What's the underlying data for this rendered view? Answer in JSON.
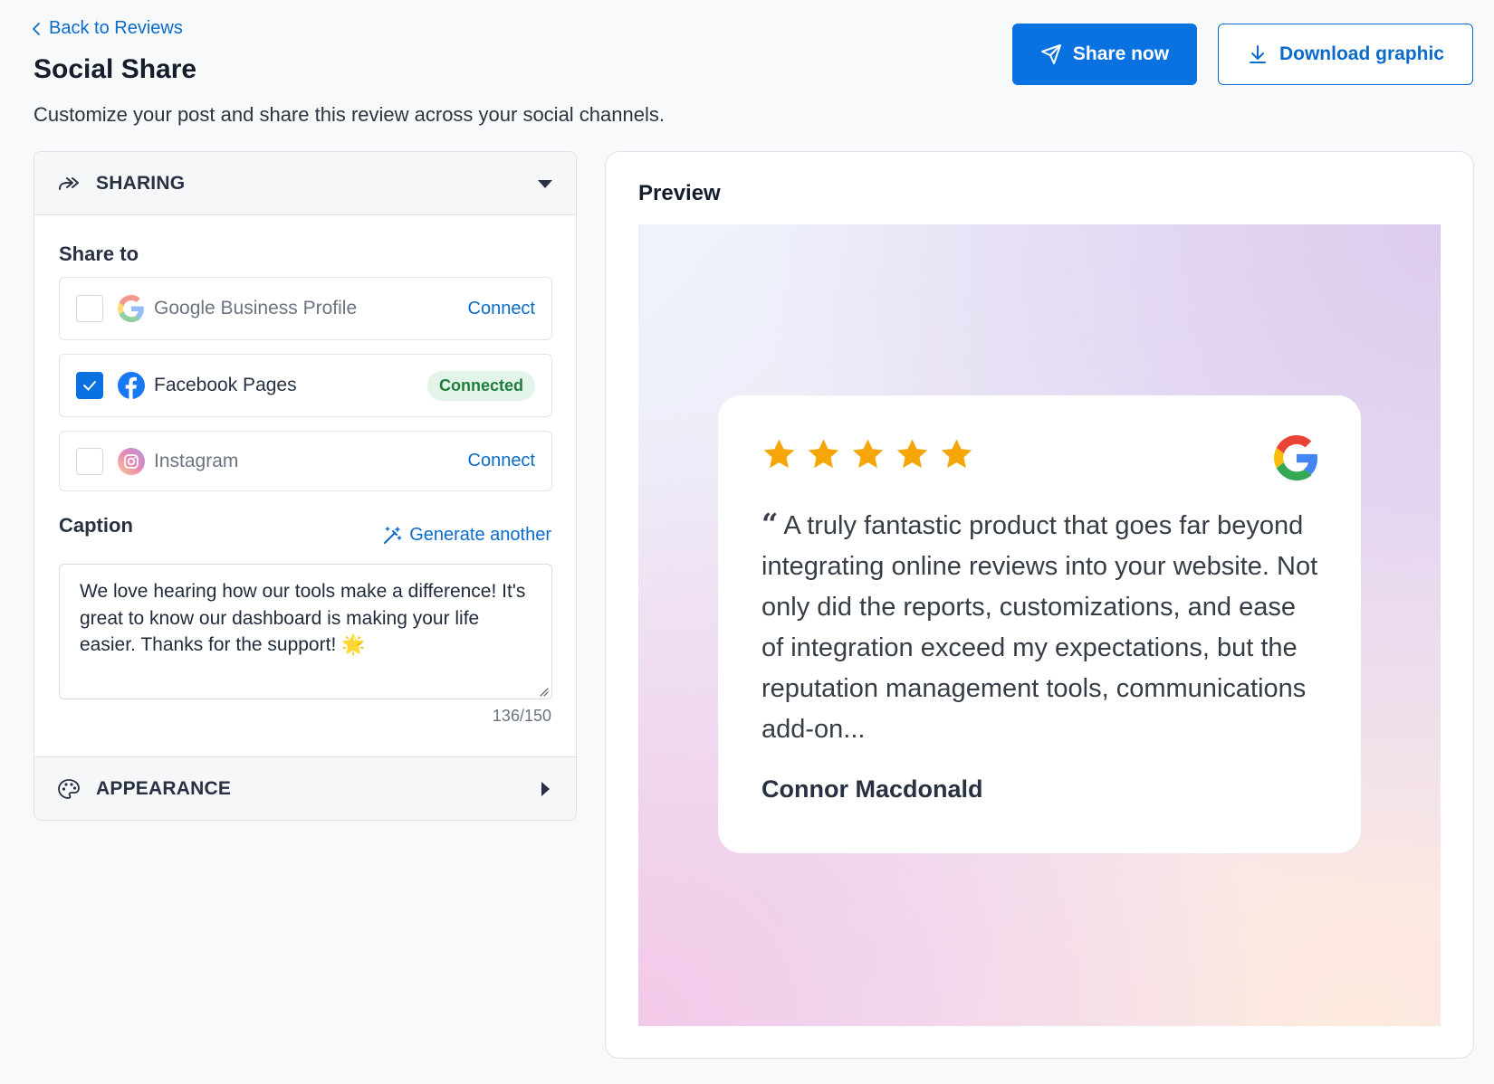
{
  "header": {
    "back_label": "Back to Reviews",
    "title": "Social Share",
    "subtitle": "Customize your post and share this review across your social channels.",
    "share_now_label": "Share now",
    "download_label": "Download graphic"
  },
  "sharing": {
    "section_title": "SHARING",
    "share_to_label": "Share to",
    "platforms": [
      {
        "name": "Google Business Profile",
        "checked": false,
        "status": "Connect",
        "icon": "google-icon"
      },
      {
        "name": "Facebook Pages",
        "checked": true,
        "status": "Connected",
        "icon": "facebook-icon"
      },
      {
        "name": "Instagram",
        "checked": false,
        "status": "Connect",
        "icon": "instagram-icon"
      }
    ],
    "caption_label": "Caption",
    "generate_label": "Generate another",
    "caption_text": "We love hearing how our tools make a difference! It's great to know our dashboard is making your life easier. Thanks for the support! 🌟",
    "char_count": "136/150"
  },
  "appearance": {
    "section_title": "APPEARANCE"
  },
  "preview": {
    "title": "Preview",
    "rating": 5,
    "quote_mark": "“",
    "review_text": "A truly fantastic product that goes far beyond integrating online reviews into your website. Not only did the reports, customizations, and ease of integration exceed my expectations, but the reputation management tools, communications add-on...",
    "reviewer": "Connor Macdonald",
    "source_icon": "google-icon"
  },
  "colors": {
    "primary": "#0a72e0",
    "link": "#0b6bcb",
    "star": "#f6a609",
    "connected_bg": "#e3f5e8",
    "connected_text": "#1e7d3b"
  }
}
